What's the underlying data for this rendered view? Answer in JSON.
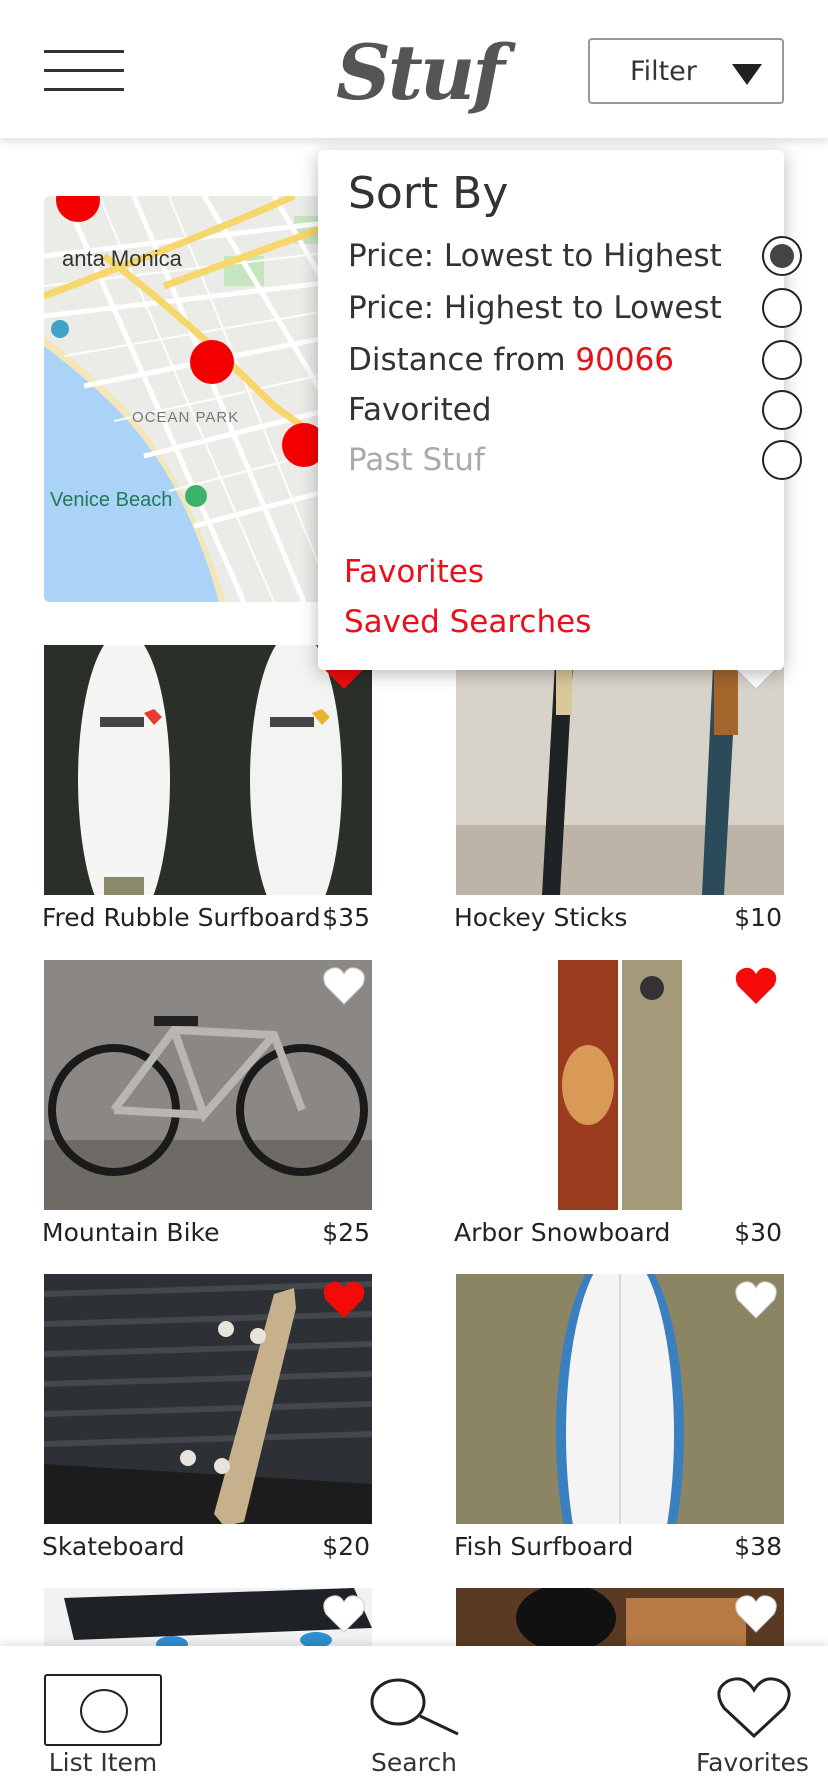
{
  "header": {
    "logo": "Stuf",
    "filter_label": "Filter"
  },
  "map": {
    "labels": {
      "santa_monica": "anta Monica",
      "ocean_park": "OCEAN PARK",
      "venice_beach": "Venice Beach"
    }
  },
  "sort_menu": {
    "title": "Sort By",
    "options": [
      {
        "label": "Price: Lowest to Highest",
        "selected": true
      },
      {
        "label": "Price: Highest to Lowest",
        "selected": false
      },
      {
        "label": "Distance from ",
        "zip": "90066",
        "selected": false
      },
      {
        "label": "Favorited",
        "selected": false
      },
      {
        "label": "Past Stuf",
        "selected": false,
        "muted": true
      }
    ],
    "links": [
      "Favorites",
      "Saved Searches"
    ]
  },
  "listings": [
    {
      "name": "Fred Rubble Surfboard",
      "price": "$35",
      "favorited": true
    },
    {
      "name": "Hockey Sticks",
      "price": "$10",
      "favorited": false
    },
    {
      "name": "Mountain Bike",
      "price": "$25",
      "favorited": false
    },
    {
      "name": "Arbor Snowboard",
      "price": "$30",
      "favorited": true
    },
    {
      "name": "Skateboard",
      "price": "$20",
      "favorited": true
    },
    {
      "name": "Fish Surfboard",
      "price": "$38",
      "favorited": false
    }
  ],
  "tabs": {
    "list_item": "List Item",
    "search": "Search",
    "favorites": "Favorites"
  },
  "colors": {
    "accent_red": "#e8101a",
    "text": "#333333"
  }
}
